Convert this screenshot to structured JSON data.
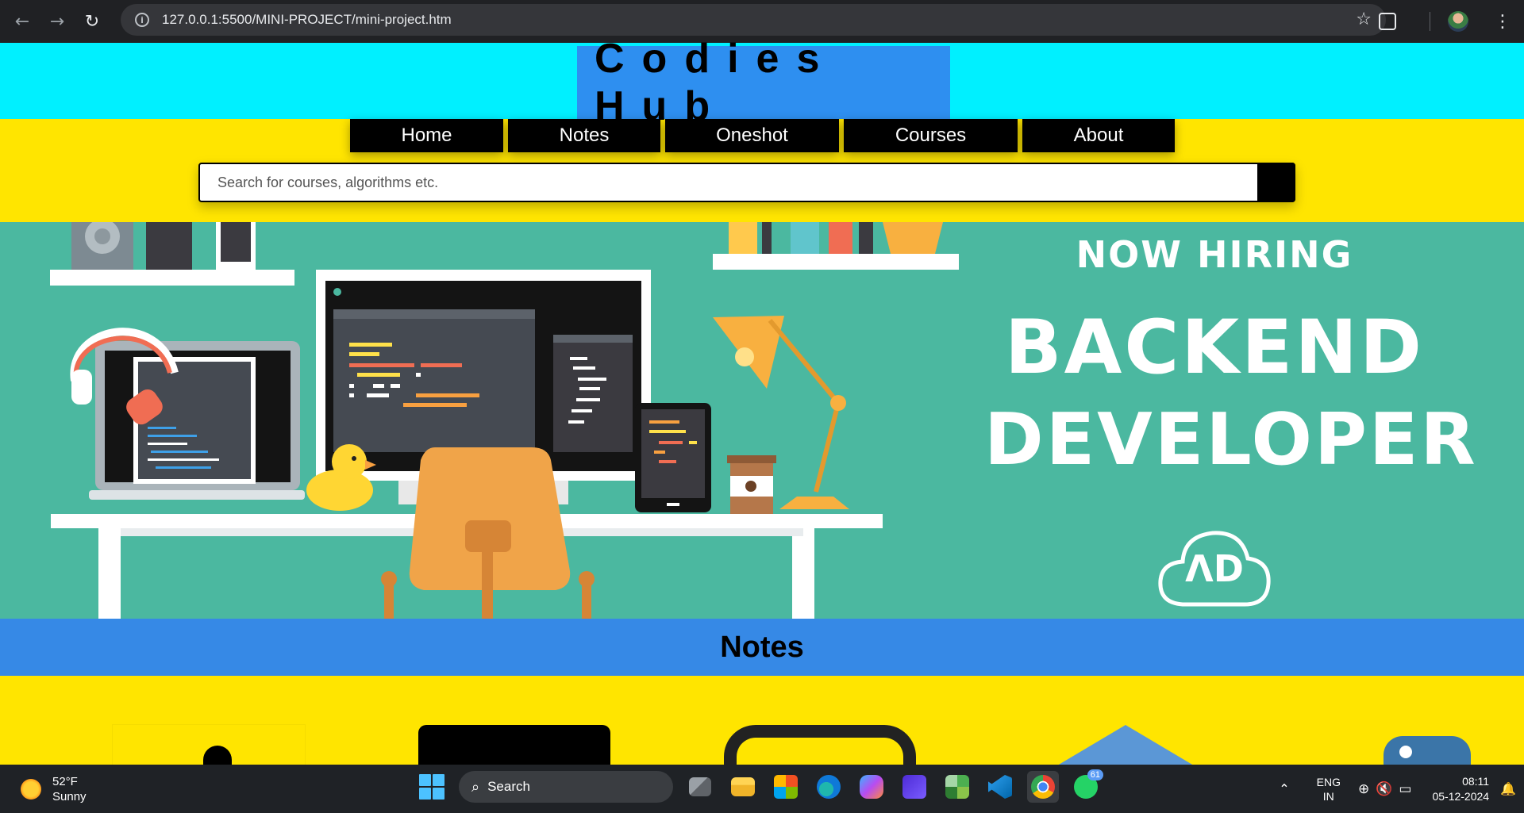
{
  "browser": {
    "url": "127.0.0.1:5500/MINI-PROJECT/mini-project.htm",
    "back_icon": "arrow-left-icon",
    "forward_icon": "arrow-right-icon",
    "reload_icon": "reload-icon",
    "menu_icon": "kebab-menu-icon"
  },
  "site": {
    "brand": "Codies Hub",
    "menu": [
      {
        "label": "Home"
      },
      {
        "label": "Notes"
      },
      {
        "label": "Oneshot"
      },
      {
        "label": "Courses"
      },
      {
        "label": "About"
      }
    ],
    "search_placeholder": "Search for courses, algorithms etc.",
    "colors": {
      "header_bg": "#00f0ff",
      "brand_bg": "#2e8ff0",
      "page_bg": "#ffe500",
      "banner_bg": "#4bb8a0",
      "section_bar": "#3689e6"
    }
  },
  "banner": {
    "line1": "NOW HIRING",
    "line2": "BACKEND",
    "line3": "DEVELOPER",
    "logo": "ΛD"
  },
  "section": {
    "title": "Notes"
  },
  "taskbar": {
    "temp": "52°F",
    "condition": "Sunny",
    "search_label": "Search",
    "whatsapp_badge": "61",
    "lang1": "ENG",
    "lang2": "IN",
    "time": "08:11",
    "date": "05-12-2024"
  }
}
